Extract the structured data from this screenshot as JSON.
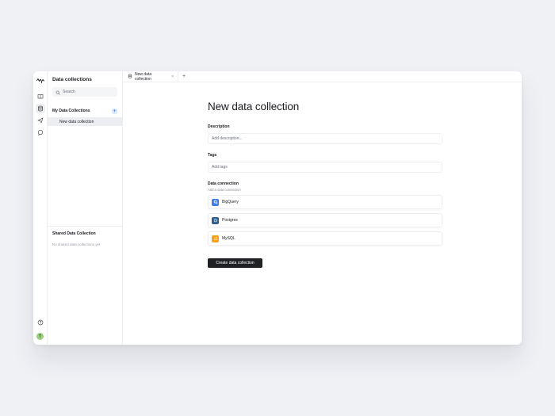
{
  "sidebar": {
    "title": "Data collections",
    "search_placeholder": "Search",
    "my_collections_title": "My Data Collections",
    "add_label": "+",
    "items": [
      {
        "label": "New data collection"
      }
    ],
    "shared_title": "Shared Data Collection",
    "shared_empty": "No shared data collections yet"
  },
  "rail": {
    "avatar_initial": "T",
    "icons": [
      "logo-icon",
      "book-icon",
      "database-icon",
      "share-icon",
      "chat-icon",
      "help-icon"
    ]
  },
  "tabs": [
    {
      "label": "New data collection",
      "close": "×"
    }
  ],
  "tab_add": "+",
  "main": {
    "title": "New data collection",
    "description_label": "Description",
    "description_placeholder": "Add description...",
    "tags_label": "Tags",
    "tags_placeholder": "Add tags",
    "connection_label": "Data connection",
    "connection_sub": "Add a data connection",
    "connections": [
      {
        "name": "BigQuery",
        "color": "#3f7ee8"
      },
      {
        "name": "Postgres",
        "color": "#2f5f8f"
      },
      {
        "name": "MySQL",
        "color": "#f5a31a"
      }
    ],
    "create_button": "Create data collection"
  }
}
